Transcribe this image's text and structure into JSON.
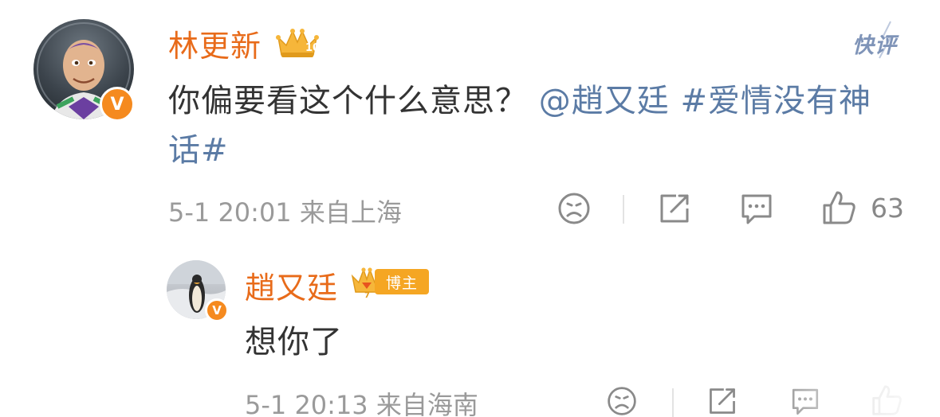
{
  "main_comment": {
    "username": "林更新",
    "badge_glyph": "V",
    "crown_level": "10",
    "quick_comment": "快评",
    "text_plain": "你偏要看这个什么意思？",
    "mention": "@趙又廷",
    "hashtag": "#爱情没有神话#",
    "timestamp": "5-1 20:01",
    "location": "来自上海",
    "like_count": "63"
  },
  "reply": {
    "username": "趙又廷",
    "badge_glyph": "V",
    "crown_level": "7",
    "label": "博主",
    "text": "想你了",
    "timestamp": "5-1 20:13",
    "location": "来自海南"
  },
  "colors": {
    "username": "#e86b1a",
    "link": "#5b7ba5",
    "meta": "#9a9a9a",
    "icon": "#8a8a8a",
    "verified": "#f58a1f",
    "label_pill": "#f5a623",
    "quick_comment": "#7f94b8"
  },
  "icons": {
    "dislike": "sad-face-icon",
    "share": "share-icon",
    "comment": "comment-icon",
    "like": "thumbs-up-icon"
  }
}
